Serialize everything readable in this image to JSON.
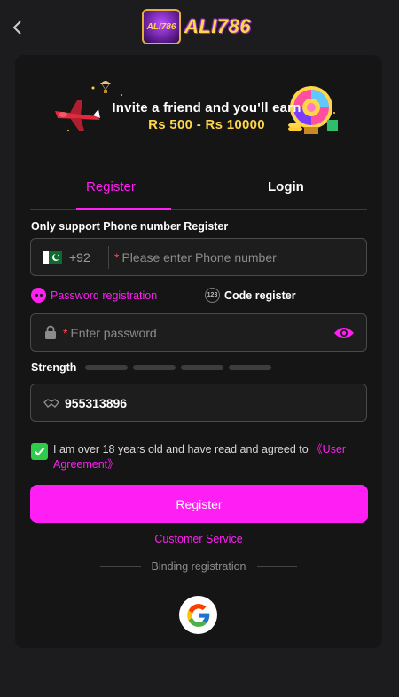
{
  "header": {
    "logo_badge": "ALI786",
    "logo_text": "ALI786"
  },
  "banner": {
    "line1": "Invite a friend and you'll earn",
    "line2": "Rs 500 - Rs 10000"
  },
  "tabs": {
    "register": "Register",
    "login": "Login",
    "active": "register"
  },
  "phone": {
    "section_label": "Only support Phone number Register",
    "country_code": "+92",
    "required_mark": "*",
    "placeholder": "Please enter Phone number"
  },
  "methods": {
    "password": "Password registration",
    "code": "Code register",
    "code_icon": "123"
  },
  "password": {
    "required_mark": "*",
    "placeholder": "Enter password"
  },
  "strength": {
    "label": "Strength",
    "level": 0,
    "segments": 4
  },
  "invite": {
    "value": "955313896"
  },
  "agreement": {
    "checked": true,
    "text": "I am over 18 years old and have read and agreed to ",
    "link": "《User Agreement》"
  },
  "actions": {
    "register": "Register",
    "customer_service": "Customer Service",
    "binding": "Binding registration"
  },
  "colors": {
    "accent": "#ff1ef4",
    "background": "#1c1c1e",
    "card": "#151515",
    "checkbox": "#2ecc4a"
  },
  "icons": [
    "back-arrow-icon",
    "lock-icon",
    "eye-icon",
    "handshake-icon",
    "google-icon",
    "pakistan-flag-icon"
  ]
}
